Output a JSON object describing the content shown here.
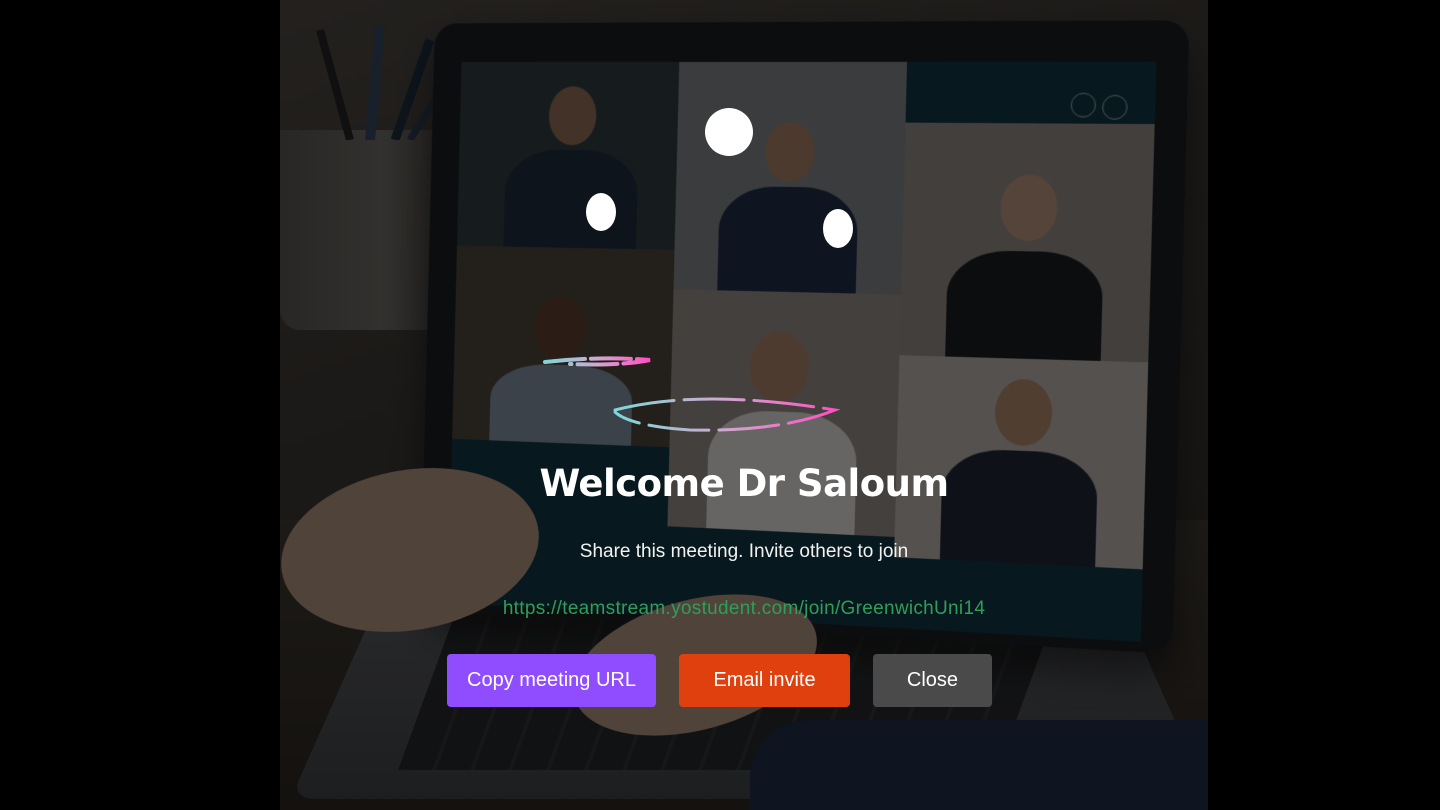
{
  "dialog": {
    "title": "Welcome Dr Saloum",
    "subtitle": "Share this meeting. Invite others to join",
    "meeting_url": "https://teamstream.yostudent.com/join/GreenwichUni14",
    "buttons": {
      "copy_label": "Copy meeting URL",
      "email_label": "Email invite",
      "close_label": "Close"
    }
  },
  "colors": {
    "copy_button": "#8f4dff",
    "email_button": "#e0400e",
    "close_button": "#4a4a4a",
    "url_text": "#2f9e5a"
  },
  "background": {
    "description_icon": "video-call-laptop-photo"
  }
}
